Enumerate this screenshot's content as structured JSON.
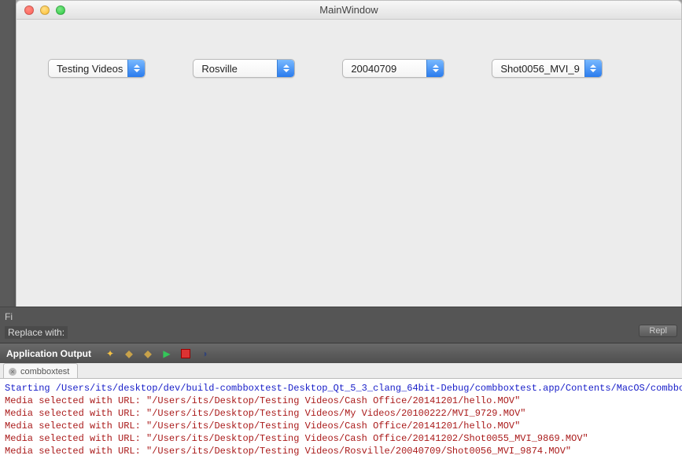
{
  "window": {
    "title": "MainWindow"
  },
  "combos": {
    "c1": "Testing Videos",
    "c2": "Rosville",
    "c3": "20040709",
    "c4": "Shot0056_MVI_9"
  },
  "ide": {
    "find_partial": "Fi",
    "replace_label": "Replace with:",
    "replace_button": "Repl",
    "output_header": "Application Output",
    "tab_name": "combboxtest"
  },
  "console": {
    "l1": "Starting /Users/its/desktop/dev/build-combboxtest-Desktop_Qt_5_3_clang_64bit-Debug/combboxtest.app/Contents/MacOS/combbo",
    "l2": "Media selected with URL: \"/Users/its/Desktop/Testing Videos/Cash Office/20141201/hello.MOV\"",
    "l3": "Media selected with URL: \"/Users/its/Desktop/Testing Videos/My Videos/20100222/MVI_9729.MOV\"",
    "l4": "Media selected with URL: \"/Users/its/Desktop/Testing Videos/Cash Office/20141201/hello.MOV\"",
    "l5": "Media selected with URL: \"/Users/its/Desktop/Testing Videos/Cash Office/20141202/Shot0055_MVI_9869.MOV\"",
    "l6": "Media selected with URL: \"/Users/its/Desktop/Testing Videos/Rosville/20040709/Shot0056_MVI_9874.MOV\""
  }
}
